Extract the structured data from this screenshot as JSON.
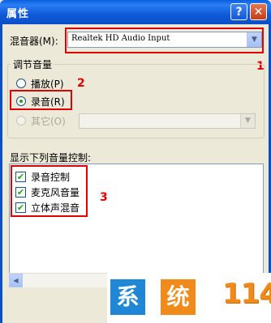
{
  "window": {
    "title": "属性",
    "help_label": "?",
    "close_label": "✕"
  },
  "mixer": {
    "label": "混音器(M):",
    "value": "Realtek HD Audio Input",
    "arrow": "▼"
  },
  "volume_group": {
    "title": "调节音量",
    "options": [
      {
        "label": "播放(P)",
        "checked": false,
        "enabled": true
      },
      {
        "label": "录音(R)",
        "checked": true,
        "enabled": true
      },
      {
        "label": "其它(O)",
        "checked": false,
        "enabled": false
      }
    ],
    "other_combo_arrow": "▼"
  },
  "controls_group": {
    "title": "显示下列音量控制:",
    "items": [
      {
        "label": "录音控制",
        "checked": true
      },
      {
        "label": "麦克风音量",
        "checked": true
      },
      {
        "label": "立体声混音",
        "checked": true
      }
    ],
    "check_glyph": "✔",
    "scroll_left": "◀",
    "scroll_right": "▶"
  },
  "annotations": {
    "box1_number": "1",
    "box2_number": "2",
    "box3_number": "3",
    "color": "#e00000"
  },
  "watermark": {
    "char1": "系",
    "char2": "统",
    "number": "114",
    "color1": "#1f87d6",
    "color2": "#f08a1a"
  }
}
